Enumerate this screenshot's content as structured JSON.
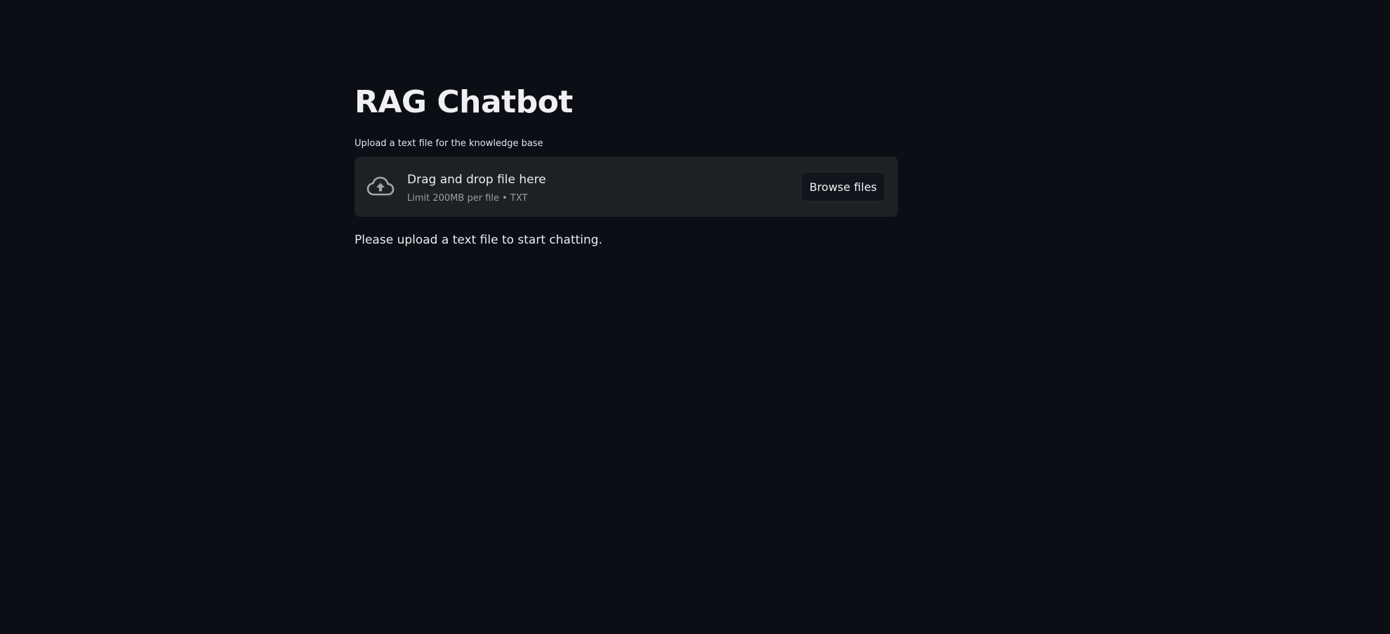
{
  "app": {
    "title": "RAG Chatbot"
  },
  "uploader": {
    "label": "Upload a text file for the knowledge base",
    "dropzone_title": "Drag and drop file here",
    "dropzone_subtitle": "Limit 200MB per file • TXT",
    "browse_label": "Browse files",
    "icon": "cloud-upload-icon"
  },
  "status": {
    "message": "Please upload a text file to start chatting."
  },
  "colors": {
    "background": "#0b0e14",
    "dropzone_background": "#1e2124",
    "button_background": "#12141c",
    "text_primary": "#f0f0f3",
    "text_secondary": "#9a9ca4"
  }
}
